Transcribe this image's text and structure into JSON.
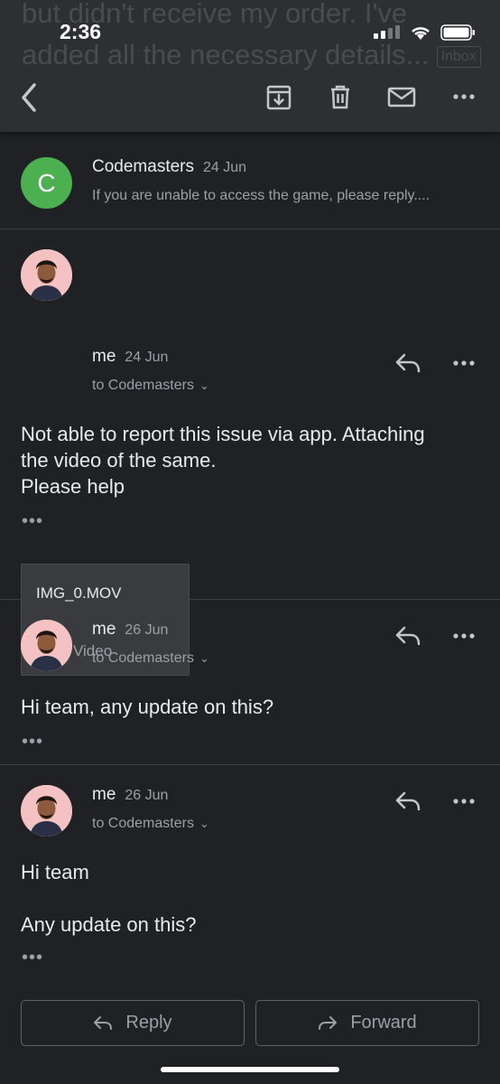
{
  "status_bar": {
    "time": "2:36"
  },
  "header": {
    "subject_ghost": "but didn't receive my order. I've added all the necessary details...",
    "subject_badge": "Inbox",
    "icons": [
      "back-icon",
      "archive-icon",
      "trash-icon",
      "mail-icon",
      "more-icon"
    ]
  },
  "thread": [
    {
      "sender": "Codemasters",
      "date": "24 Jun",
      "avatar_letter": "C",
      "avatar_color": "#4caf50",
      "snippet": "If you are unable to access the game, please reply...."
    },
    {
      "sender": "me",
      "date": "24 Jun",
      "to": "to Codemasters",
      "body": "Not able to report this issue via app. Attaching\nthe video of the same.\nPlease help",
      "ellipsis": "•••",
      "attachment": {
        "name": "IMG_0.MOV",
        "type": "Video",
        "icon_color": "#e04b3c"
      }
    },
    {
      "sender": "me",
      "date": "26 Jun",
      "to": "to Codemasters",
      "body": "Hi team, any update on this?",
      "ellipsis": "•••"
    },
    {
      "sender": "me",
      "date": "26 Jun",
      "to": "to Codemasters",
      "body": "Hi team\n\nAny update on this?",
      "ellipsis": "•••"
    }
  ],
  "actions": {
    "reply": "Reply",
    "forward": "Forward"
  },
  "colors": {
    "background": "#202124",
    "header": "#2e2f32",
    "text": "#e8eaed",
    "muted": "#9aa0a6"
  }
}
